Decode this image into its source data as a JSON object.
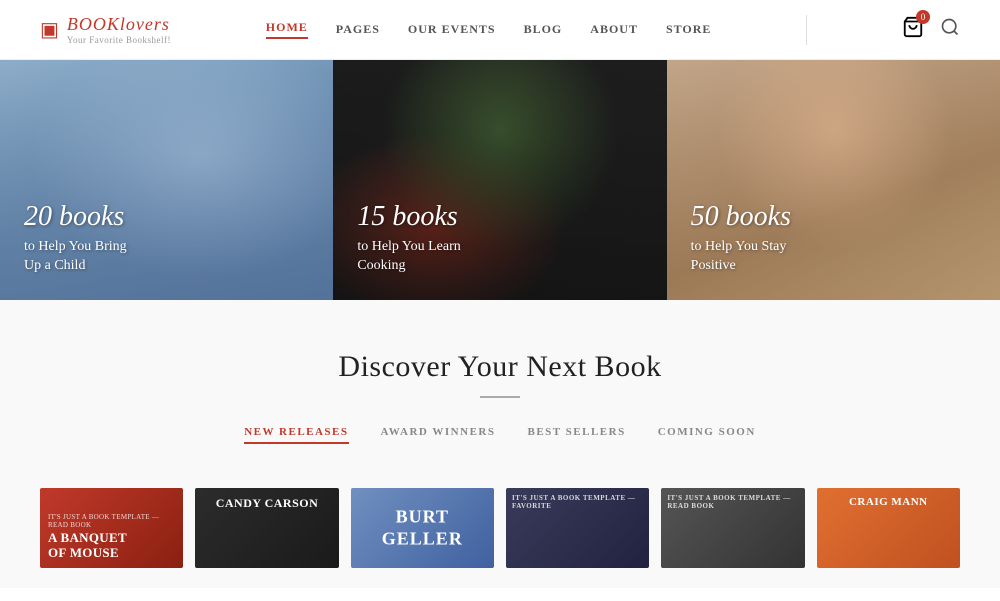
{
  "header": {
    "logo": {
      "name_plain": "BOOK",
      "name_italic": "lovers",
      "tagline": "Your Favorite Bookshelf!"
    },
    "nav": {
      "items": [
        {
          "label": "HOME",
          "active": true
        },
        {
          "label": "PAGES",
          "active": false
        },
        {
          "label": "OUR EVENTS",
          "active": false
        },
        {
          "label": "BLOG",
          "active": false
        },
        {
          "label": "ABOUT",
          "active": false
        },
        {
          "label": "STORE",
          "active": false
        }
      ]
    },
    "cart_badge": "0",
    "icons": {
      "cart": "🛒",
      "search": "🔍"
    }
  },
  "hero": {
    "panels": [
      {
        "count": "20 books",
        "description": "to Help You Bring\nUp a Child"
      },
      {
        "count": "15 books",
        "description": "to Help You Learn\nCooking"
      },
      {
        "count": "50 books",
        "description": "to Help You Stay\nPositive"
      }
    ]
  },
  "discover": {
    "title": "Discover Your Next Book",
    "tabs": [
      {
        "label": "NEW RELEASES",
        "active": true
      },
      {
        "label": "AWARD WINNERS",
        "active": false
      },
      {
        "label": "BEST SELLERS",
        "active": false
      },
      {
        "label": "COMING SOON",
        "active": false
      }
    ],
    "books": [
      {
        "id": 1,
        "title": "A BANQUET OF MOUSE",
        "color_class": "book-1"
      },
      {
        "id": 2,
        "title": "CANDY CARSON",
        "color_class": "book-2"
      },
      {
        "id": 3,
        "title": "BURT GELLER",
        "color_class": "book-3"
      },
      {
        "id": 4,
        "title": "IT'S JUST A BOOK",
        "color_class": "book-4"
      },
      {
        "id": 5,
        "title": "IT'S JUST A BOOK TEMPLATE",
        "color_class": "book-5"
      },
      {
        "id": 6,
        "title": "CRAIG MANN",
        "color_class": "book-6"
      }
    ]
  }
}
